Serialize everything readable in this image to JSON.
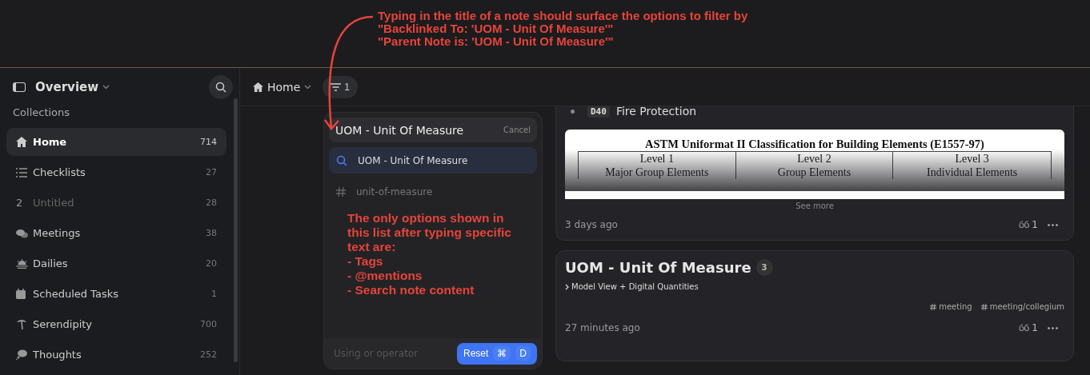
{
  "annotation": {
    "lines": [
      "Typing in the title of a note should surface the options to filter by",
      "\"Backlinked To: 'UOM - Unit Of Measure'\"",
      "\"Parent Note is: 'UOM - Unit Of Measure'\""
    ]
  },
  "sidebar": {
    "title": "Overview",
    "section": "Collections",
    "items": [
      {
        "kind": "home",
        "label": "Home",
        "count": "714",
        "selected": true,
        "disabled": false
      },
      {
        "kind": "list",
        "label": "Checklists",
        "count": "27",
        "selected": false,
        "disabled": false
      },
      {
        "kind": "numbered",
        "number": "2",
        "label": "Untitled",
        "count": "28",
        "selected": false,
        "disabled": true
      },
      {
        "kind": "chat",
        "label": "Meetings",
        "count": "38",
        "selected": false,
        "disabled": false
      },
      {
        "kind": "sunrise",
        "label": "Dailies",
        "count": "20",
        "selected": false,
        "disabled": false
      },
      {
        "kind": "calendar",
        "label": "Scheduled Tasks",
        "count": "1",
        "selected": false,
        "disabled": false
      },
      {
        "kind": "palm",
        "label": "Serendipity",
        "count": "700",
        "selected": false,
        "disabled": false
      },
      {
        "kind": "thought",
        "label": "Thoughts",
        "count": "252",
        "selected": false,
        "disabled": false
      }
    ]
  },
  "toolbar": {
    "collection": "Home",
    "filter_count": "1"
  },
  "filter_popup": {
    "query": "UOM - Unit Of Measure",
    "cancel": "Cancel",
    "options": [
      {
        "kind": "search",
        "label": "UOM - Unit Of Measure",
        "selected": true
      },
      {
        "kind": "tag",
        "label": "unit-of-measure",
        "selected": false
      }
    ],
    "note": [
      "The only options shown in",
      "this list after typing specific",
      "text are:",
      "- Tags",
      "- @mentions",
      "- Search note content"
    ],
    "placeholder": "Using or operator",
    "reset": "Reset",
    "keys": [
      "⌘",
      "D"
    ]
  },
  "cards": [
    {
      "bullet_code": "D40",
      "bullet_text": "Fire Protection",
      "image": {
        "title": "ASTM Uniformat II Classification for Building Elements (E1557-97)",
        "columns": [
          [
            "Level 1",
            "Major Group Elements"
          ],
          [
            "Level 2",
            "Group Elements"
          ],
          [
            "Level 3",
            "Individual Elements"
          ]
        ]
      },
      "see_more": "See more",
      "time": "3 days ago",
      "backlinks": "1"
    },
    {
      "title": "UOM - Unit Of Measure",
      "badge": "3",
      "breadcrumb": "Model View + Digital Quantities",
      "tags": [
        "meeting",
        "meeting/collegium"
      ],
      "time": "27 minutes ago",
      "backlinks": "1"
    }
  ]
}
